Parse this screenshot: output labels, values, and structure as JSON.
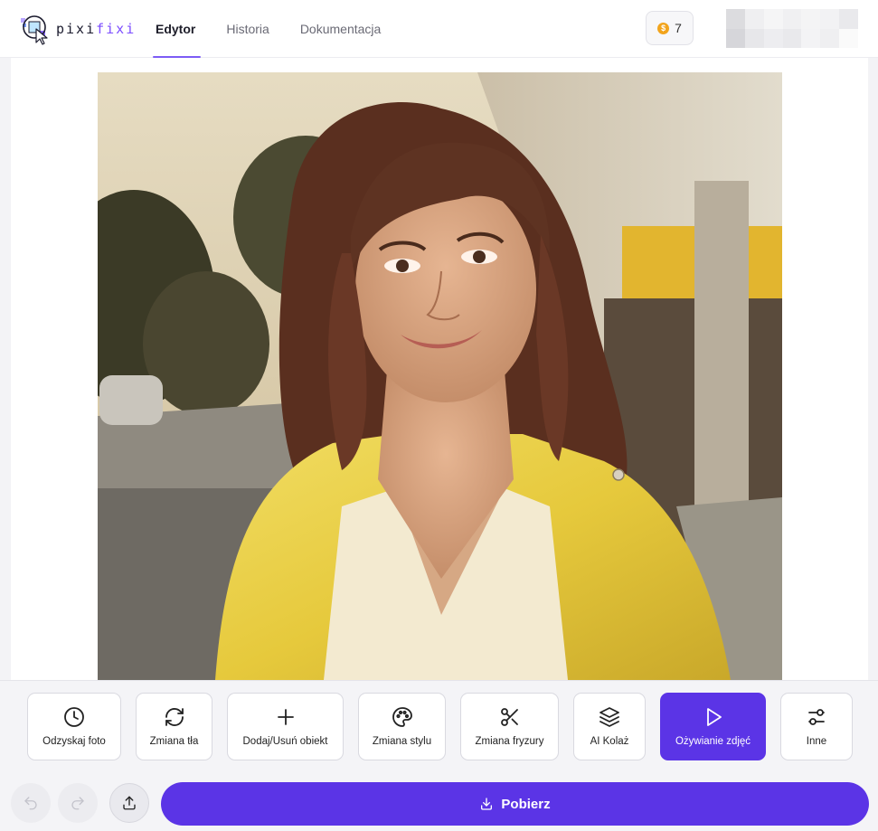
{
  "app": {
    "logo_part1": "pixi",
    "logo_part2": "fixi"
  },
  "nav": {
    "items": [
      {
        "label": "Edytor",
        "active": true
      },
      {
        "label": "Historia",
        "active": false
      },
      {
        "label": "Dokumentacja",
        "active": false
      }
    ]
  },
  "credits": {
    "count": "7",
    "icon": "coin-icon"
  },
  "tools": [
    {
      "label": "Odzyskaj foto",
      "icon": "clock-icon",
      "active": false
    },
    {
      "label": "Zmiana tła",
      "icon": "refresh-icon",
      "active": false
    },
    {
      "label": "Dodaj/Usuń obiekt",
      "icon": "plus-icon",
      "active": false
    },
    {
      "label": "Zmiana stylu",
      "icon": "palette-icon",
      "active": false
    },
    {
      "label": "Zmiana fryzury",
      "icon": "scissors-icon",
      "active": false
    },
    {
      "label": "AI Kolaż",
      "icon": "layers-icon",
      "active": false
    },
    {
      "label": "Ożywianie zdjęć",
      "icon": "play-icon",
      "active": true
    },
    {
      "label": "Inne",
      "icon": "sliders-icon",
      "active": false
    }
  ],
  "actions": {
    "undo_icon": "undo-icon",
    "redo_icon": "redo-icon",
    "upload_icon": "upload-icon",
    "download_label": "Pobierz"
  },
  "colors": {
    "accent": "#5b34e6",
    "nav_underline": "#7c5cf5",
    "coin": "#f2a41c"
  }
}
